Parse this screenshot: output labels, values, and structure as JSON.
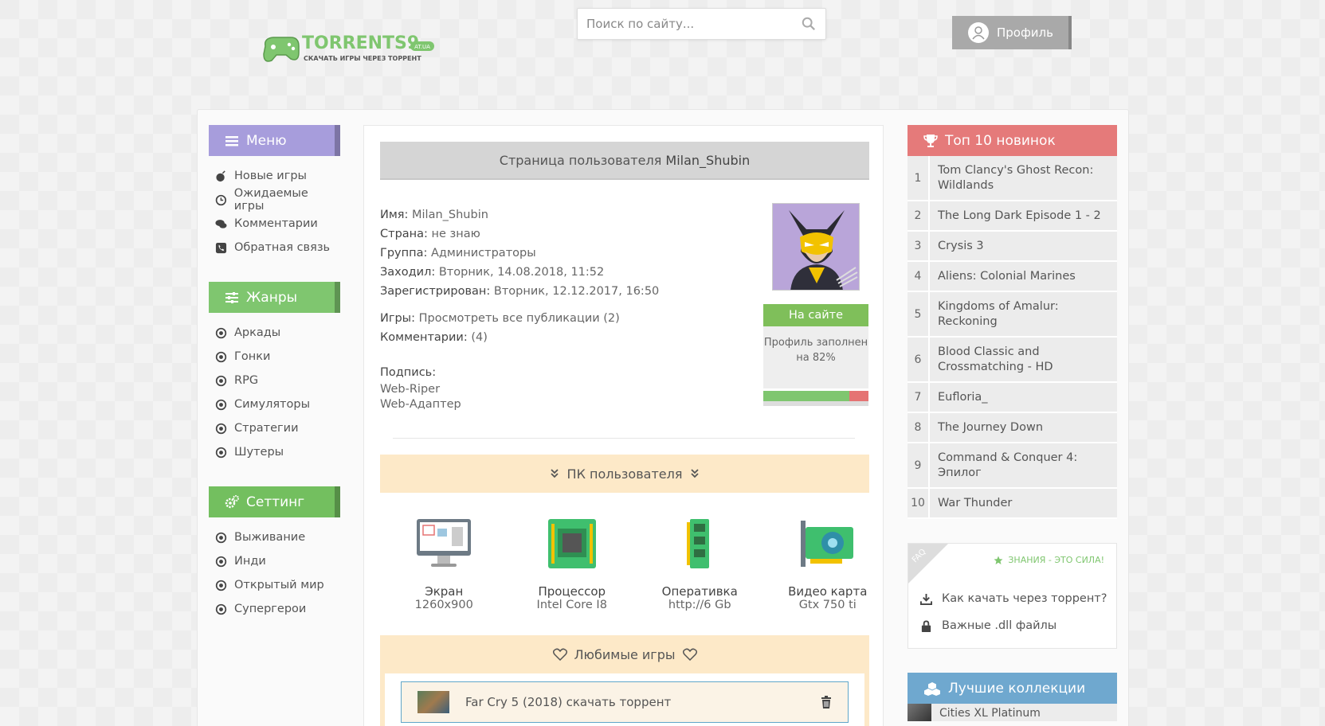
{
  "header": {
    "logo_text": "TORRENTS9",
    "logo_domain": "AT.UA",
    "logo_tagline": "СКАЧАТЬ ИГРЫ ЧЕРЕЗ ТОРРЕНТ",
    "search_placeholder": "Поиск по сайту...",
    "search_icon": "search-icon",
    "profile_label": "Профиль",
    "profile_icon": "user-icon"
  },
  "sidebar": {
    "menu": {
      "title": "Меню",
      "items": [
        {
          "label": "Новые игры",
          "icon": "bomb-icon"
        },
        {
          "label": "Ожидаемые игры",
          "icon": "clock-icon"
        },
        {
          "label": "Комментарии",
          "icon": "comments-icon"
        },
        {
          "label": "Обратная связь",
          "icon": "phone-icon"
        }
      ]
    },
    "genres": {
      "title": "Жанры",
      "items": [
        "Аркады",
        "Гонки",
        "RPG",
        "Симуляторы",
        "Стратегии",
        "Шутеры"
      ]
    },
    "setting": {
      "title": "Сеттинг",
      "items": [
        "Выживание",
        "Инди",
        "Открытый мир",
        "Супергерои"
      ]
    }
  },
  "user": {
    "title_prefix": "Страница пользователя",
    "username": "Milan_Shubin",
    "fields": {
      "name_label": "Имя:",
      "name_value": "Milan_Shubin",
      "country_label": "Страна:",
      "country_value": "не знаю",
      "group_label": "Группа:",
      "group_value": "Администраторы",
      "visited_label": "Заходил:",
      "visited_value": "Вторник, 14.08.2018, 11:52",
      "registered_label": "Зарегистрирован:",
      "registered_value": "Вторник, 12.12.2017, 16:50",
      "games_label": "Игры:",
      "games_value": "Просмотреть все публикации (2)",
      "comments_label": "Комментарии:",
      "comments_value": "(4)",
      "signature_label": "Подпись:",
      "signature_line1": "Web-Riper",
      "signature_line2": "Web-Адаптер"
    },
    "status": "На сайте",
    "profile_fill_text": "Профиль заполнен на 82%",
    "profile_fill_percent": 82
  },
  "pc": {
    "title": "ПК пользователя",
    "items": [
      {
        "label": "Экран",
        "value": "1260x900",
        "icon": "monitor-icon"
      },
      {
        "label": "Процессор",
        "value": "Intel Core I8",
        "icon": "cpu-icon"
      },
      {
        "label": "Оперативка",
        "value": "http://6 Gb",
        "icon": "ram-icon"
      },
      {
        "label": "Видео карта",
        "value": "Gtx 750 ti",
        "icon": "gpu-icon"
      }
    ]
  },
  "favorites": {
    "title": "Любимые игры",
    "items": [
      {
        "label": "Far Cry 5 (2018) скачать торрент"
      }
    ]
  },
  "top10": {
    "title": "Топ 10 новинок",
    "items": [
      {
        "num": "1",
        "title": "Tom Clancy's Ghost Recon: Wildlands"
      },
      {
        "num": "2",
        "title": "The Long Dark Episode 1 - 2"
      },
      {
        "num": "3",
        "title": "Crysis 3"
      },
      {
        "num": "4",
        "title": "Aliens: Colonial Marines"
      },
      {
        "num": "5",
        "title": "Kingdoms of Amalur: Reckoning"
      },
      {
        "num": "6",
        "title": "Blood Classic and Crossmatching - HD"
      },
      {
        "num": "7",
        "title": "Eufloria_"
      },
      {
        "num": "8",
        "title": "The Journey Down"
      },
      {
        "num": "9",
        "title": "Command & Conquer 4: Эпилог"
      },
      {
        "num": "10",
        "title": "War Thunder"
      }
    ]
  },
  "faq": {
    "corner": "FAQ",
    "slogan": "ЗНАНИЯ - ЭТО СИЛА!",
    "items": [
      {
        "label": "Как качать через торрент?",
        "icon": "download-icon"
      },
      {
        "label": "Важные .dll файлы",
        "icon": "lock-icon"
      }
    ]
  },
  "best": {
    "title": "Лучшие коллекции",
    "first_item": "Cities XL Platinum"
  },
  "colors": {
    "menu": "#a79ddc",
    "genres": "#7fc66f",
    "top10": "#e57a7a",
    "best": "#6fa8cf",
    "pc_header": "#fde9c8"
  }
}
